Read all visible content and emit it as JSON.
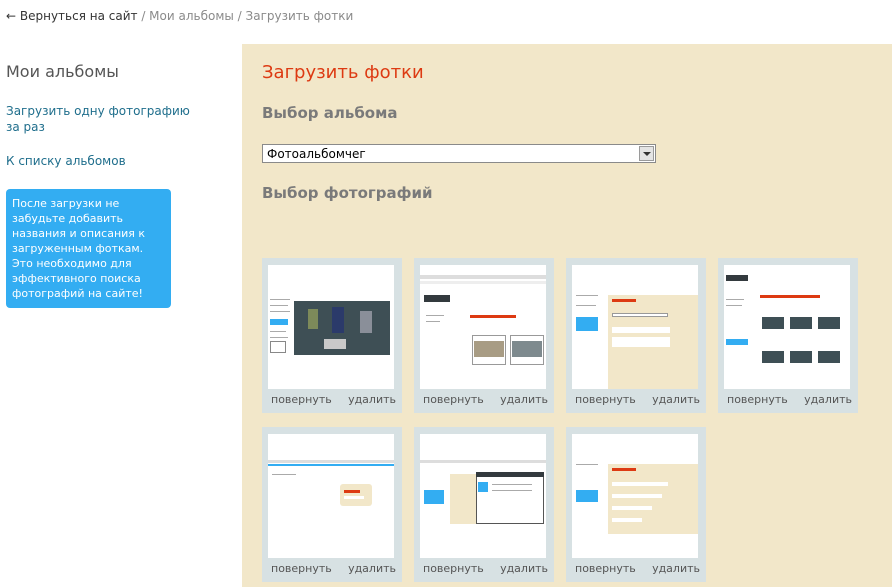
{
  "breadcrumb": {
    "back": "← Вернуться на сайт",
    "sep1": " / ",
    "albums": "Мои альбомы",
    "sep2": " / ",
    "current": "Загрузить фотки"
  },
  "sidebar": {
    "title": "Мои альбомы",
    "upload_one": "Загрузить одну фотографию за раз",
    "to_list": "К списку альбомов",
    "hint": "После загрузки не забудьте добавить названия и описания к загруженным фоткам. Это необходимо для эффективного поиска фотографий на сайте!"
  },
  "main": {
    "title": "Загрузить фотки",
    "album_heading": "Выбор альбома",
    "album_selected": "Фотоальбомчег",
    "photos_heading": "Выбор фотографий"
  },
  "photos": [
    {
      "rotate": "повернуть",
      "delete": "удалить"
    },
    {
      "rotate": "повернуть",
      "delete": "удалить"
    },
    {
      "rotate": "повернуть",
      "delete": "удалить"
    },
    {
      "rotate": "повернуть",
      "delete": "удалить"
    },
    {
      "rotate": "повернуть",
      "delete": "удалить"
    },
    {
      "rotate": "повернуть",
      "delete": "удалить"
    },
    {
      "rotate": "повернуть",
      "delete": "удалить"
    }
  ],
  "colors": {
    "accent_title": "#dd3a12",
    "panel_bg": "#f2e7c9",
    "hint_bg": "#33adf2",
    "tile_bg": "#d7e1e3"
  },
  "icons": {
    "back_arrow": "left-arrow-icon",
    "dropdown": "chevron-down-icon"
  }
}
